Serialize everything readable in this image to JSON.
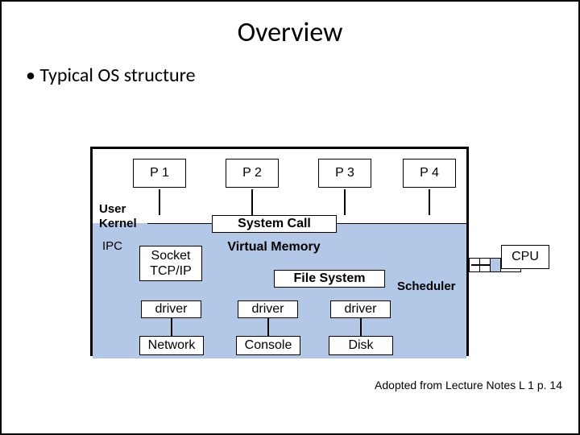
{
  "title": "Overview",
  "bullet": "Typical OS structure",
  "processes": [
    "P 1",
    "P 2",
    "P 3",
    "P 4"
  ],
  "user_label": "User",
  "kernel_label": "Kernel",
  "syscall": "System Call",
  "ipc": "IPC",
  "vm": "Virtual Memory",
  "socket_l1": "Socket",
  "socket_l2": "TCP/IP",
  "fs": "File System",
  "scheduler": "Scheduler",
  "driver": "driver",
  "devices": [
    "Network",
    "Console",
    "Disk"
  ],
  "cpu": "CPU",
  "credit": "Adopted from Lecture Notes L 1 p. 14"
}
